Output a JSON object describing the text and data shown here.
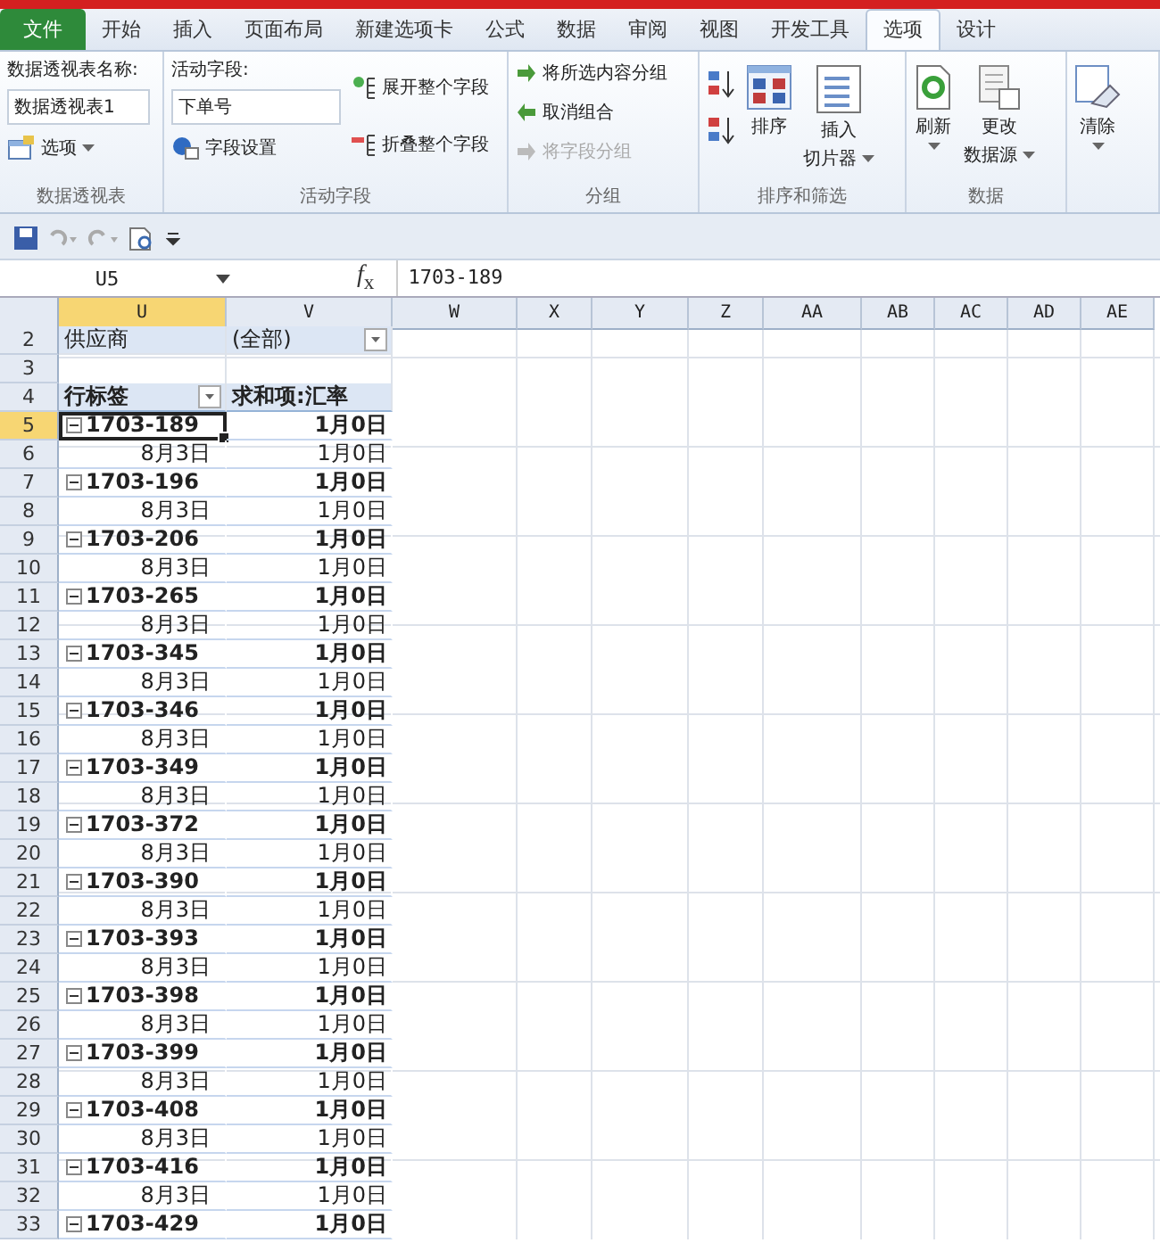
{
  "ribbon_tabs": [
    {
      "label": "文件",
      "kind": "file",
      "selected": false
    },
    {
      "label": "开始",
      "kind": "tab",
      "selected": false
    },
    {
      "label": "插入",
      "kind": "tab",
      "selected": false
    },
    {
      "label": "页面布局",
      "kind": "tab",
      "selected": false
    },
    {
      "label": "新建选项卡",
      "kind": "tab",
      "selected": false
    },
    {
      "label": "公式",
      "kind": "tab",
      "selected": false
    },
    {
      "label": "数据",
      "kind": "tab",
      "selected": false
    },
    {
      "label": "审阅",
      "kind": "tab",
      "selected": false
    },
    {
      "label": "视图",
      "kind": "tab",
      "selected": false
    },
    {
      "label": "开发工具",
      "kind": "tab",
      "selected": false
    },
    {
      "label": "选项",
      "kind": "tab",
      "selected": true
    },
    {
      "label": "设计",
      "kind": "tab",
      "selected": false
    }
  ],
  "ribbon": {
    "pivot_table": {
      "name_label": "数据透视表名称:",
      "name_value": "数据透视表1",
      "options_button": "选项",
      "group_label": "数据透视表"
    },
    "active_field": {
      "field_label": "活动字段:",
      "field_value": "下单号",
      "settings_button": "字段设置",
      "expand_button": "展开整个字段",
      "collapse_button": "折叠整个字段",
      "group_label": "活动字段"
    },
    "group": {
      "buttons": [
        {
          "label": "将所选内容分组",
          "disabled": false
        },
        {
          "label": "取消组合",
          "disabled": false
        },
        {
          "label": "将字段分组",
          "disabled": true
        }
      ],
      "group_label": "分组"
    },
    "sort_filter": {
      "sort_button": "排序",
      "slicer_button": [
        "插入",
        "切片器"
      ],
      "group_label": "排序和筛选"
    },
    "data": {
      "refresh_button": "刷新",
      "change_source_button": [
        "更改",
        "数据源"
      ],
      "group_label": "数据"
    },
    "clear_button": "清除"
  },
  "formula_bar": {
    "name_box": "U5",
    "function_label": "*f*$_{x}$",
    "formula": "1703-189"
  },
  "columns": [
    {
      "label": "U",
      "selected": true
    },
    {
      "label": "V",
      "selected": false
    },
    {
      "label": "W",
      "selected": false
    },
    {
      "label": "X",
      "selected": false
    },
    {
      "label": "Y",
      "selected": false
    },
    {
      "label": "Z",
      "selected": false
    },
    {
      "label": "AA",
      "selected": false
    },
    {
      "label": "AB",
      "selected": false
    },
    {
      "label": "AC",
      "selected": false
    },
    {
      "label": "AD",
      "selected": false
    },
    {
      "label": "AE",
      "selected": false
    }
  ],
  "pivot": {
    "filter": {
      "row": "2",
      "label": "供应商",
      "value": "(全部)"
    },
    "blank_row": "3",
    "header": {
      "row": "4",
      "row_label": "行标签",
      "value_label": "求和项:汇率"
    },
    "rows": [
      {
        "row": "5",
        "kind": "group",
        "label": "1703-189",
        "value": "1月0日",
        "expanded": true,
        "selected": true
      },
      {
        "row": "6",
        "kind": "item",
        "label": "8月3日",
        "value": "1月0日",
        "selected": false
      },
      {
        "row": "7",
        "kind": "group",
        "label": "1703-196",
        "value": "1月0日",
        "expanded": true,
        "selected": false
      },
      {
        "row": "8",
        "kind": "item",
        "label": "8月3日",
        "value": "1月0日",
        "selected": false
      },
      {
        "row": "9",
        "kind": "group",
        "label": "1703-206",
        "value": "1月0日",
        "expanded": true,
        "selected": false
      },
      {
        "row": "10",
        "kind": "item",
        "label": "8月3日",
        "value": "1月0日",
        "selected": false
      },
      {
        "row": "11",
        "kind": "group",
        "label": "1703-265",
        "value": "1月0日",
        "expanded": true,
        "selected": false
      },
      {
        "row": "12",
        "kind": "item",
        "label": "8月3日",
        "value": "1月0日",
        "selected": false
      },
      {
        "row": "13",
        "kind": "group",
        "label": "1703-345",
        "value": "1月0日",
        "expanded": true,
        "selected": false
      },
      {
        "row": "14",
        "kind": "item",
        "label": "8月3日",
        "value": "1月0日",
        "selected": false
      },
      {
        "row": "15",
        "kind": "group",
        "label": "1703-346",
        "value": "1月0日",
        "expanded": true,
        "selected": false
      },
      {
        "row": "16",
        "kind": "item",
        "label": "8月3日",
        "value": "1月0日",
        "selected": false
      },
      {
        "row": "17",
        "kind": "group",
        "label": "1703-349",
        "value": "1月0日",
        "expanded": true,
        "selected": false
      },
      {
        "row": "18",
        "kind": "item",
        "label": "8月3日",
        "value": "1月0日",
        "selected": false
      },
      {
        "row": "19",
        "kind": "group",
        "label": "1703-372",
        "value": "1月0日",
        "expanded": true,
        "selected": false
      },
      {
        "row": "20",
        "kind": "item",
        "label": "8月3日",
        "value": "1月0日",
        "selected": false
      },
      {
        "row": "21",
        "kind": "group",
        "label": "1703-390",
        "value": "1月0日",
        "expanded": true,
        "selected": false
      },
      {
        "row": "22",
        "kind": "item",
        "label": "8月3日",
        "value": "1月0日",
        "selected": false
      },
      {
        "row": "23",
        "kind": "group",
        "label": "1703-393",
        "value": "1月0日",
        "expanded": true,
        "selected": false
      },
      {
        "row": "24",
        "kind": "item",
        "label": "8月3日",
        "value": "1月0日",
        "selected": false
      },
      {
        "row": "25",
        "kind": "group",
        "label": "1703-398",
        "value": "1月0日",
        "expanded": true,
        "selected": false
      },
      {
        "row": "26",
        "kind": "item",
        "label": "8月3日",
        "value": "1月0日",
        "selected": false
      },
      {
        "row": "27",
        "kind": "group",
        "label": "1703-399",
        "value": "1月0日",
        "expanded": true,
        "selected": false
      },
      {
        "row": "28",
        "kind": "item",
        "label": "8月3日",
        "value": "1月0日",
        "selected": false
      },
      {
        "row": "29",
        "kind": "group",
        "label": "1703-408",
        "value": "1月0日",
        "expanded": true,
        "selected": false
      },
      {
        "row": "30",
        "kind": "item",
        "label": "8月3日",
        "value": "1月0日",
        "selected": false
      },
      {
        "row": "31",
        "kind": "group",
        "label": "1703-416",
        "value": "1月0日",
        "expanded": true,
        "selected": false
      },
      {
        "row": "32",
        "kind": "item",
        "label": "8月3日",
        "value": "1月0日",
        "selected": false
      },
      {
        "row": "33",
        "kind": "group",
        "label": "1703-429",
        "value": "1月0日",
        "expanded": true,
        "selected": false
      }
    ]
  }
}
